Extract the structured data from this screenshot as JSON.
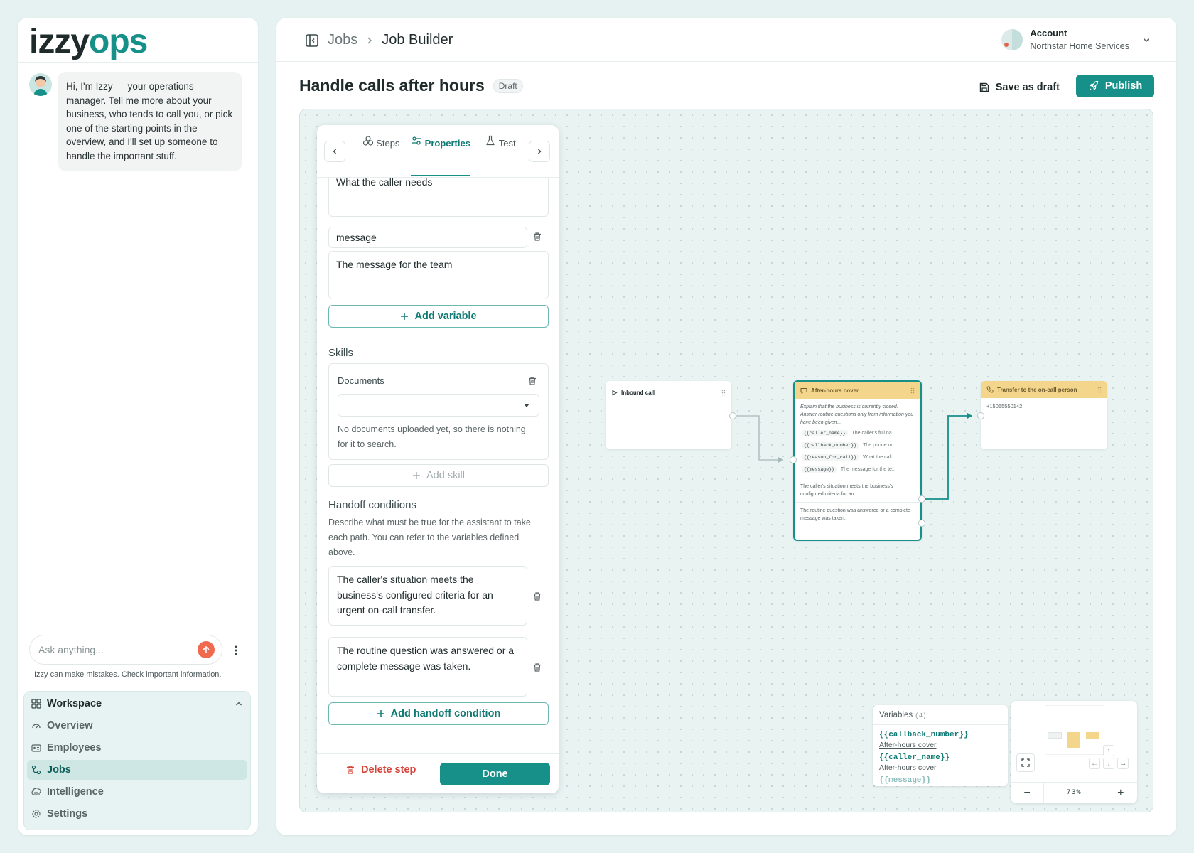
{
  "brand": {
    "logo_part1": "izzy",
    "logo_part2": "ops",
    "accent": "#17908a"
  },
  "chat": {
    "message": "Hi, I'm Izzy — your operations manager. Tell me more about your business, who tends to call you, or pick one of the starting points in the overview, and I'll set up someone to handle the important stuff.",
    "input_placeholder": "Ask anything...",
    "disclaimer": "Izzy can make mistakes. Check important information."
  },
  "workspace": {
    "title": "Workspace",
    "items": [
      {
        "label": "Overview",
        "icon": "gauge-icon"
      },
      {
        "label": "Employees",
        "icon": "id-card-icon"
      },
      {
        "label": "Jobs",
        "icon": "workflow-icon",
        "active": true
      },
      {
        "label": "Intelligence",
        "icon": "brain-icon"
      },
      {
        "label": "Settings",
        "icon": "gear-icon"
      }
    ]
  },
  "header": {
    "breadcrumb": [
      "Jobs",
      "Job Builder"
    ],
    "account_label": "Account",
    "account_name": "Northstar Home Services"
  },
  "job": {
    "title": "Handle calls after hours",
    "status": "Draft",
    "save_label": "Save as draft",
    "publish_label": "Publish"
  },
  "properties": {
    "tabs": [
      "Steps",
      "Properties",
      "Test"
    ],
    "active_tab": "Properties",
    "prev_var_description": "What the caller needs",
    "variable_name": "message",
    "variable_description": "The message for the team",
    "add_variable": "Add variable",
    "skills_title": "Skills",
    "skill_name": "Documents",
    "skill_select_value": "",
    "skill_note": "No documents uploaded yet, so there is nothing for it to search.",
    "add_skill": "Add skill",
    "handoff_title": "Handoff conditions",
    "handoff_desc": "Describe what must be true for the assistant to take each path. You can refer to the variables defined above.",
    "conditions": [
      "The caller's situation meets the business's configured criteria for an urgent on-call transfer.",
      "The routine question was answered or a complete message was taken."
    ],
    "add_condition": "Add handoff condition",
    "delete_label": "Delete step",
    "done_label": "Done"
  },
  "nodes": {
    "inbound": {
      "title": "Inbound call"
    },
    "cover": {
      "title": "After-hours cover",
      "text": "Explain that the business is currently closed. Answer routine questions only from information you have been given...",
      "vars": [
        {
          "name": "{{caller_name}}",
          "desc": "The caller's full na..."
        },
        {
          "name": "{{callback_number}}",
          "desc": "The phone nu..."
        },
        {
          "name": "{{reason_for_call}}",
          "desc": "What the call..."
        },
        {
          "name": "{{message}}",
          "desc": "The message for the te..."
        }
      ],
      "path1": "The caller's situation meets the business's configured criteria for an...",
      "path2": "The routine question was answered or a complete message was taken."
    },
    "transfer": {
      "title": "Transfer to the on-call person",
      "number": "+15065550142"
    }
  },
  "variables_panel": {
    "title": "Variables",
    "count": "(4)",
    "items": [
      {
        "name": "{{callback_number}}",
        "source": "After-hours cover"
      },
      {
        "name": "{{caller_name}}",
        "source": "After-hours cover"
      },
      {
        "name": "{{message}}",
        "source": ""
      }
    ]
  },
  "minimap": {
    "zoom": "73%"
  }
}
